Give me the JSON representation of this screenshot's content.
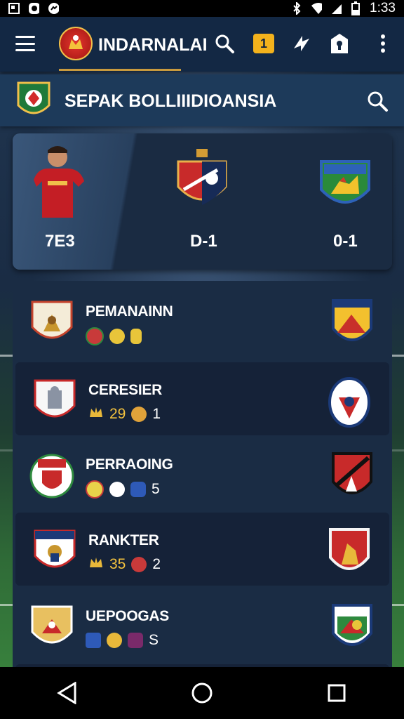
{
  "status_bar": {
    "time": "1:33",
    "icons_left": [
      "notification-icon",
      "whatsapp-icon",
      "messenger-icon"
    ],
    "icons_right": [
      "bluetooth-icon",
      "wifi-icon",
      "signal-icon",
      "battery-icon"
    ]
  },
  "app_bar": {
    "title": "INDARNALAI",
    "badge": "1"
  },
  "search_bar": {
    "title": "SEPAK BOLLIIIDIOANSIA"
  },
  "featured": {
    "player_score": "7E3",
    "match1_score": "D-1",
    "match2_score": "0-1"
  },
  "matches": [
    {
      "name": "PEMANAINN",
      "stat1": "",
      "stat2": "",
      "stat3": ""
    },
    {
      "name": "CERESIER",
      "stat1": "29",
      "stat2": "1",
      "stat3": ""
    },
    {
      "name": "PERRAOING",
      "stat1": "",
      "stat2": "5",
      "stat3": ""
    },
    {
      "name": "RANKTER",
      "stat1": "35",
      "stat2": "2",
      "stat3": ""
    },
    {
      "name": "UEPOOGAS",
      "stat1": "",
      "stat2": "S",
      "stat3": ""
    }
  ],
  "colors": {
    "accent": "#f3b21c",
    "appbar": "#132844",
    "card": "#1a2c44"
  }
}
